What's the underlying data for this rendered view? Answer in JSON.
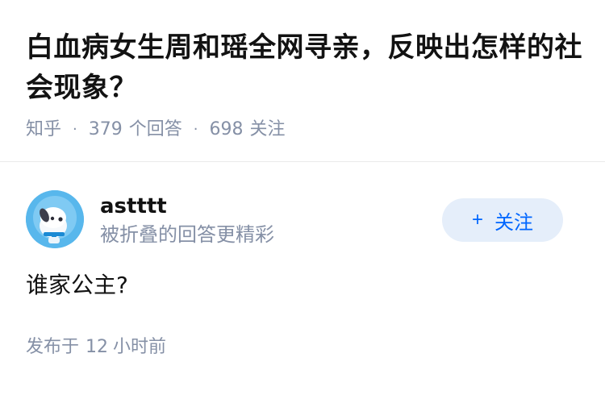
{
  "question": {
    "title": "白血病女生周和瑶全网寻亲，反映出怎样的社会现象？",
    "source": "知乎",
    "answer_count": "379",
    "answer_label": "个回答",
    "follower_count": "698",
    "follower_label": "关注"
  },
  "answer": {
    "author_name": "astttt",
    "author_badge": "被折叠的回答更精彩",
    "follow_label": "关注",
    "follow_icon": "plus-icon",
    "content": "谁家公主?",
    "time_prefix": "发布于",
    "time_value": "12",
    "time_unit": "小时前"
  },
  "colors": {
    "meta_gray": "#8590a6",
    "accent_blue": "#0066ff",
    "follow_bg": "#e5eefa"
  }
}
